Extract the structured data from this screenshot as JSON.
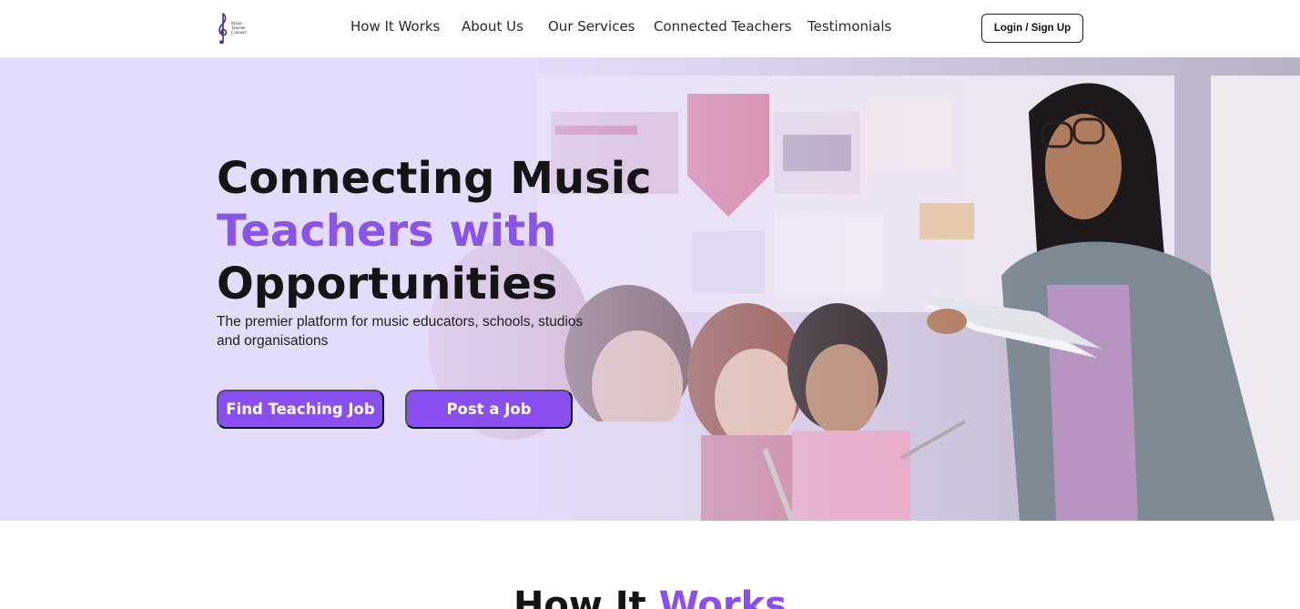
{
  "brand": {
    "logo_text": [
      "Music",
      "Teacher",
      "Connect"
    ],
    "accent_color": "#8a4ff0"
  },
  "nav": {
    "items": [
      {
        "label": "How It Works"
      },
      {
        "label": "About Us"
      },
      {
        "label": "Our Services"
      },
      {
        "label": "Connected Teachers"
      },
      {
        "label": "Testimonials"
      }
    ],
    "login_label": "Login / Sign Up"
  },
  "hero": {
    "title_line1": "Connecting Music",
    "title_line2": "Teachers with",
    "title_line3": "Opportunities",
    "subtitle": "The premier platform for music educators, schools, studios and organisations",
    "primary_button": "Find Teaching Job",
    "secondary_button": "Post a Job"
  },
  "section": {
    "title_part1": "How It",
    "title_part2": "Works"
  }
}
